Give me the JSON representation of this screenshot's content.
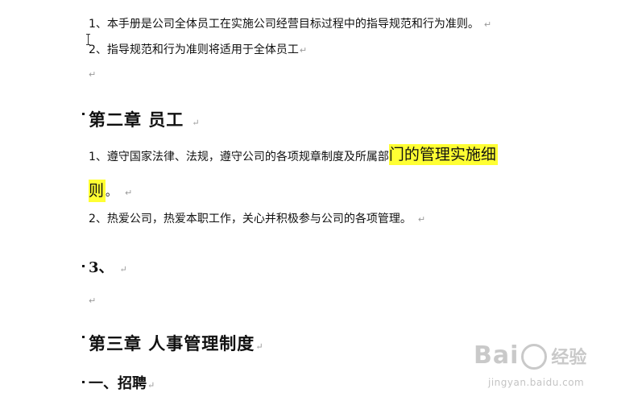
{
  "document": {
    "para_1": "1、本手册是公司全体员工在实施公司经营目标过程中的指导规范和行为准则。",
    "para_2": "2、指导规范和行为准则将适用于全体员工",
    "chapter_2_heading": "第二章  员工",
    "ch2_para_1_prefix": "1、遵守国家法律、法规，遵守公司的各项规章制度及所属部",
    "ch2_para_1_highlight": "门的管理实施细",
    "ch2_para_1_highlight_2": "则",
    "ch2_para_1_suffix": "。",
    "ch2_para_2": "2、热爱公司，热爱本职工作，关心并积极参与公司的各项管理。",
    "item_3_heading": "3、",
    "chapter_3_heading": "第三章  人事管理制度",
    "section_1_heading": "一、招聘",
    "paragraph_mark": "↵"
  },
  "watermark": {
    "logo_text": "Bai",
    "logo_text_2": "经验",
    "url": "jingyan.baidu.com"
  },
  "colors": {
    "highlight": "#ffff33",
    "mark": "#9a9a9a",
    "watermark": "#c9c9c9"
  }
}
